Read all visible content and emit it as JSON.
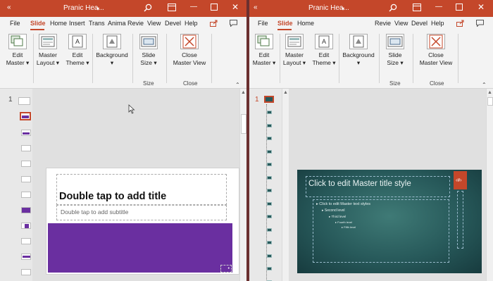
{
  "left": {
    "window_title": "Pranic Hea...",
    "tabs": [
      "File",
      "Slide",
      "Home",
      "Insert",
      "Trans",
      "Anima",
      "Revie",
      "View",
      "Devel",
      "Help"
    ],
    "active_tab": "Slide",
    "ribbon": {
      "edit_master": [
        "Edit",
        "Master"
      ],
      "master_layout": [
        "Master",
        "Layout"
      ],
      "edit_theme": [
        "Edit",
        "Theme"
      ],
      "background": "Background",
      "slide_size": [
        "Slide",
        "Size"
      ],
      "close_master_view": [
        "Close",
        "Master View"
      ],
      "group_size": "Size",
      "group_close": "Close"
    },
    "slide_number": "1",
    "slide": {
      "title_placeholder": "Double tap to add title",
      "subtitle_placeholder": "Double tap to add subtitle"
    }
  },
  "right": {
    "window_title": "Pranic Hea...",
    "tabs": [
      "File",
      "Slide",
      "Home",
      "Revie",
      "View",
      "Devel",
      "Help"
    ],
    "active_tab": "Slide",
    "ribbon": {
      "edit_master": [
        "Edit",
        "Master"
      ],
      "master_layout": [
        "Master",
        "Layout"
      ],
      "edit_theme": [
        "Edit",
        "Theme"
      ],
      "background": "Background",
      "slide_size": [
        "Slide",
        "Size"
      ],
      "close_master_view": [
        "Close",
        "Master View"
      ],
      "group_size": "Size",
      "group_close": "Close"
    },
    "slide_number": "1",
    "master_slide": {
      "title": "Click to edit Master title style",
      "page_number_tag": "‹#›",
      "levels": [
        "Click to edit Master text styles",
        "Second level",
        "Third level",
        "Fourth level",
        "Fifth level"
      ]
    }
  },
  "colors": {
    "accent": "#c4472a",
    "purple": "#6a2fa0",
    "teal_bg": "#27595a"
  },
  "icons": {
    "back": "back-arrow-icon",
    "search": "search-icon",
    "ribbon_display": "ribbon-display-icon",
    "minimize": "minimize-icon",
    "maximize": "maximize-icon",
    "close": "close-icon",
    "share": "share-icon",
    "comments": "comments-icon"
  }
}
